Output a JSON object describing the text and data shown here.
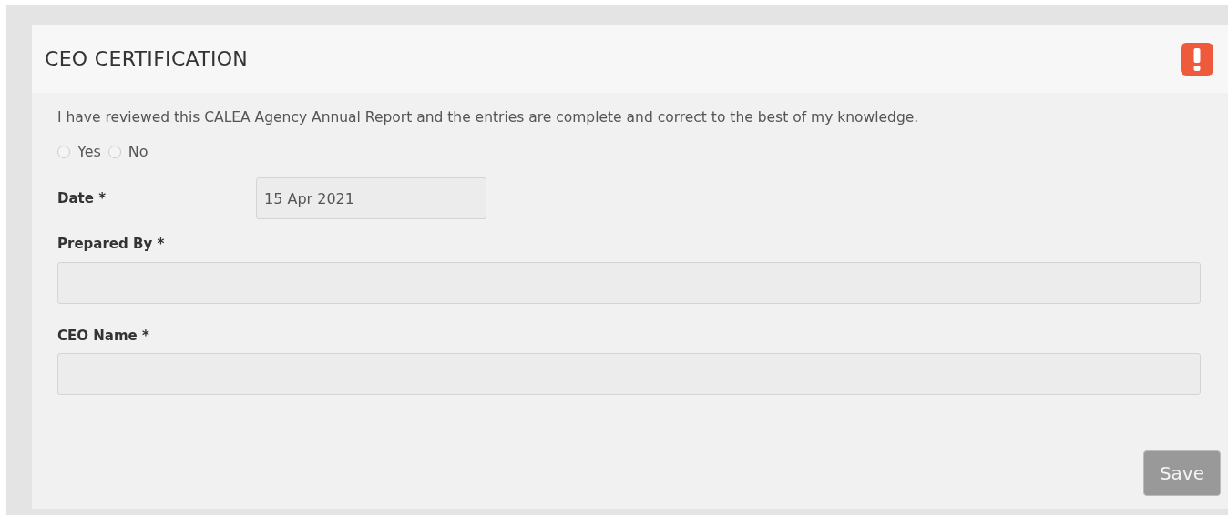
{
  "panel": {
    "title": "CEO CERTIFICATION",
    "alert": true
  },
  "statement": "I have reviewed this CALEA Agency Annual Report and the entries are complete and correct to the best of my knowledge.",
  "options": [
    {
      "label": "Yes",
      "selected": false
    },
    {
      "label": "No",
      "selected": false
    }
  ],
  "fields": [
    {
      "kind": "inline",
      "label": "Date *",
      "value": "15 Apr 2021"
    },
    {
      "kind": "stacked",
      "label": "Prepared By *"
    },
    {
      "kind": "stacked",
      "label": "CEO Name *"
    }
  ],
  "save_button": {
    "label": "Save",
    "disabled": true
  }
}
